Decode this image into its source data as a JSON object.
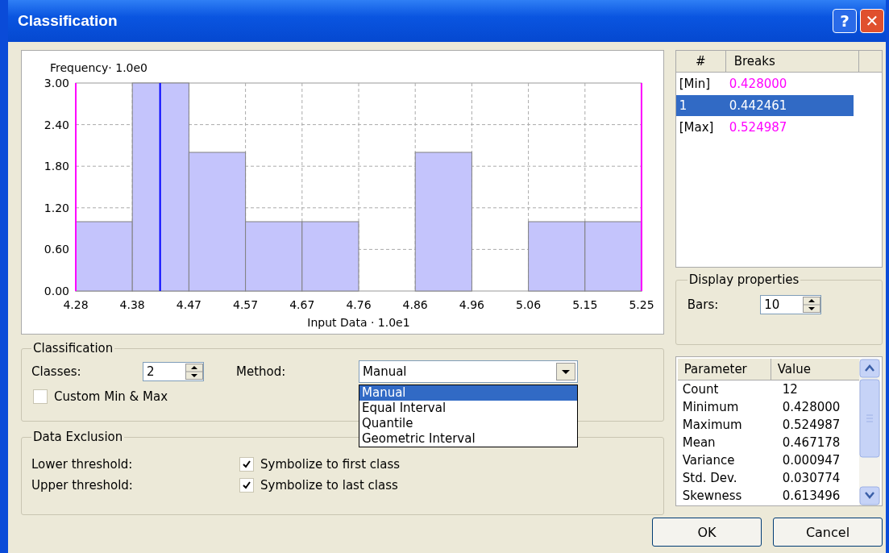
{
  "window": {
    "title": "Classification",
    "buttons": [
      "?",
      "✕"
    ]
  },
  "histogram": {
    "bin_edge_labels": [
      "4.28",
      "4.38",
      "4.47",
      "4.57",
      "4.67",
      "4.76",
      "4.86",
      "4.96",
      "5.06",
      "5.15",
      "5.25"
    ],
    "chart_data": {
      "type": "bar",
      "title": "Frequency· 1.0e0",
      "xlabel": "Input Data · 1.0e1",
      "values": [
        1,
        3,
        2,
        1,
        1,
        0,
        2,
        0,
        1,
        1
      ],
      "ylim": [
        0,
        3
      ],
      "grid": true,
      "yticks": [
        {
          "value": 0,
          "label": "0.00"
        },
        {
          "value": 0.6,
          "label": "0.60"
        },
        {
          "value": 1.2,
          "label": "1.20"
        },
        {
          "value": 1.8,
          "label": "1.80"
        },
        {
          "value": 2.4,
          "label": "2.40"
        },
        {
          "value": 3,
          "label": "3.00"
        }
      ]
    }
  },
  "breaks": {
    "columns": [
      "#",
      "Breaks"
    ],
    "rows": [
      {
        "label": "[Min]",
        "value": "0.428000",
        "kind": "limit",
        "selected": false
      },
      {
        "label": "1",
        "value": "0.442461",
        "kind": "break",
        "selected": true
      },
      {
        "label": "[Max]",
        "value": "0.524987",
        "kind": "limit",
        "selected": false
      }
    ]
  },
  "display_properties": {
    "title": "Display properties",
    "bars_label": "Bars:",
    "bars_value": "10"
  },
  "classification": {
    "title": "Classification",
    "classes_label": "Classes:",
    "classes_value": "2",
    "method_label": "Method:",
    "method_value": "Manual",
    "custom_min_max": {
      "label": "Custom Min & Max",
      "checked": false
    },
    "method_options": [
      {
        "label": "Manual",
        "selected": true
      },
      {
        "label": "Equal Interval",
        "selected": false
      },
      {
        "label": "Quantile",
        "selected": false
      },
      {
        "label": "Geometric Interval",
        "selected": false
      }
    ]
  },
  "data_exclusion": {
    "title": "Data Exclusion",
    "rows": [
      {
        "label": "Lower threshold:",
        "option": "Symbolize to first class",
        "checked": true
      },
      {
        "label": "Upper threshold:",
        "option": "Symbolize to last class",
        "checked": true
      }
    ]
  },
  "statistics": {
    "columns": [
      "Parameter",
      "Value"
    ],
    "rows": [
      [
        "Count",
        "12"
      ],
      [
        "Minimum",
        "0.428000"
      ],
      [
        "Maximum",
        "0.524987"
      ],
      [
        "Mean",
        "0.467178"
      ],
      [
        "Variance",
        "0.000947"
      ],
      [
        "Std. Dev.",
        "0.030774"
      ],
      [
        "Skewness",
        "0.613496"
      ]
    ]
  },
  "buttons": [
    "OK",
    "Cancel"
  ]
}
